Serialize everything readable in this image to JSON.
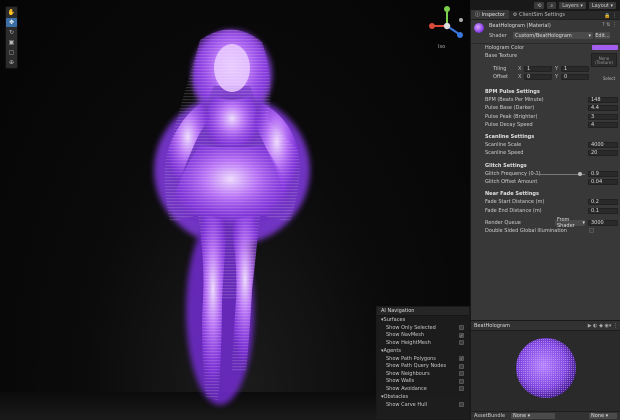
{
  "toolbar": {
    "layers_label": "Layers",
    "layout_label": "Layout"
  },
  "tabs": [
    {
      "label": "Inspector"
    },
    {
      "label": "ClientSim Settings"
    }
  ],
  "material": {
    "name": "BeatHologram (Material)",
    "shader_label": "Shader",
    "shader_value": "Custom/BeatHologram",
    "edit_label": "Edit...",
    "hologram_color_label": "Hologram Color",
    "hologram_color": "#a35ef0",
    "base_texture_label": "Base Texture",
    "texture_slot_text": "None (Texture)",
    "tiling_label": "Tiling",
    "offset_label": "Offset",
    "tiling": {
      "x": "1",
      "y": "1"
    },
    "offset": {
      "x": "0",
      "y": "0"
    },
    "select_label": "Select"
  },
  "bpm": {
    "heading": "BPM Pulse Settings",
    "rows": [
      {
        "label": "BPM (Beats Per Minute)",
        "value": "148"
      },
      {
        "label": "Pulse Base (Darker)",
        "value": "4.4"
      },
      {
        "label": "Pulse Peak (Brighter)",
        "value": "3"
      },
      {
        "label": "Pulse Decay Speed",
        "value": "4"
      }
    ]
  },
  "scanline": {
    "heading": "Scanline Settings",
    "rows": [
      {
        "label": "Scanline Scale",
        "value": "4000"
      },
      {
        "label": "Scanline Speed",
        "value": "20"
      }
    ]
  },
  "glitch": {
    "heading": "Glitch Settings",
    "frequency_label": "Glitch Frequency (0-1)",
    "frequency_value": "0.9",
    "offset_label": "Glitch Offset Amount",
    "offset_value": "0.04"
  },
  "nearfade": {
    "heading": "Near Fade Settings",
    "rows": [
      {
        "label": "Fade Start Distance (m)",
        "value": "0.2"
      },
      {
        "label": "Fade End Distance (m)",
        "value": "0.1"
      }
    ]
  },
  "render": {
    "queue_label": "Render Queue",
    "queue_mode": "From Shader",
    "queue_value": "3000",
    "double_sided_label": "Double Sided Global Illumination"
  },
  "preview": {
    "title": "BeatHologram",
    "assetbundle_label": "AssetBundle",
    "assetbundle_value": "None",
    "variant_value": "None"
  },
  "scene": {
    "gizmo_label": "Iso"
  },
  "ai_navigation": {
    "title": "AI Navigation",
    "sections": [
      {
        "title": "Surfaces",
        "items": [
          {
            "label": "Show Only Selected",
            "checked": false
          },
          {
            "label": "Show NavMesh",
            "checked": true
          },
          {
            "label": "Show HeightMesh",
            "checked": false
          }
        ]
      },
      {
        "title": "Agents",
        "items": [
          {
            "label": "Show Path Polygons",
            "checked": true
          },
          {
            "label": "Show Path Query Nodes",
            "checked": false
          },
          {
            "label": "Show Neighbours",
            "checked": false
          },
          {
            "label": "Show Walls",
            "checked": false
          },
          {
            "label": "Show Avoidance",
            "checked": false
          }
        ]
      },
      {
        "title": "Obstacles",
        "items": [
          {
            "label": "Show Carve Hull",
            "checked": false
          }
        ]
      }
    ]
  },
  "colors": {
    "accent": "#3a6ea5",
    "hologram": "#b06cff"
  }
}
